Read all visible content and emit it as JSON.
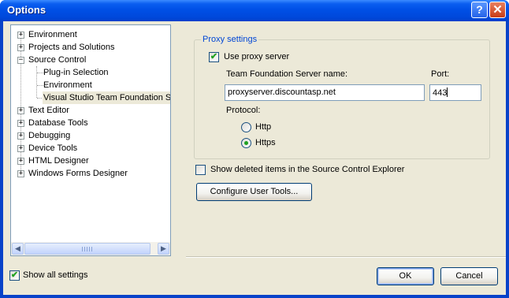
{
  "window": {
    "title": "Options",
    "help_glyph": "?",
    "close_glyph": "✕"
  },
  "tree": {
    "items": [
      {
        "label": "Environment",
        "expander": "+"
      },
      {
        "label": "Projects and Solutions",
        "expander": "+"
      },
      {
        "label": "Source Control",
        "expander": "−"
      },
      {
        "label": "Plug-in Selection"
      },
      {
        "label": "Environment"
      },
      {
        "label": "Visual Studio Team Foundation Se",
        "selected": true
      },
      {
        "label": "Text Editor",
        "expander": "+"
      },
      {
        "label": "Database Tools",
        "expander": "+"
      },
      {
        "label": "Debugging",
        "expander": "+"
      },
      {
        "label": "Device Tools",
        "expander": "+"
      },
      {
        "label": "HTML Designer",
        "expander": "+"
      },
      {
        "label": "Windows Forms Designer",
        "expander": "+"
      }
    ],
    "scroll_left": "◀",
    "scroll_right": "▶"
  },
  "proxy": {
    "group_label": "Proxy settings",
    "use_proxy_label": "Use proxy server",
    "use_proxy_checked": true,
    "server_label": "Team Foundation Server name:",
    "server_value": "proxyserver.discountasp.net",
    "port_label": "Port:",
    "port_value": "443",
    "protocol_label": "Protocol:",
    "http_label": "Http",
    "https_label": "Https",
    "selected_protocol": "Https"
  },
  "show_deleted": {
    "label": "Show deleted items in the Source Control Explorer",
    "checked": false
  },
  "configure_tools_label": "Configure User Tools...",
  "show_all": {
    "label": "Show all settings",
    "checked": true
  },
  "buttons": {
    "ok": "OK",
    "cancel": "Cancel"
  },
  "check_glyph": "✔"
}
